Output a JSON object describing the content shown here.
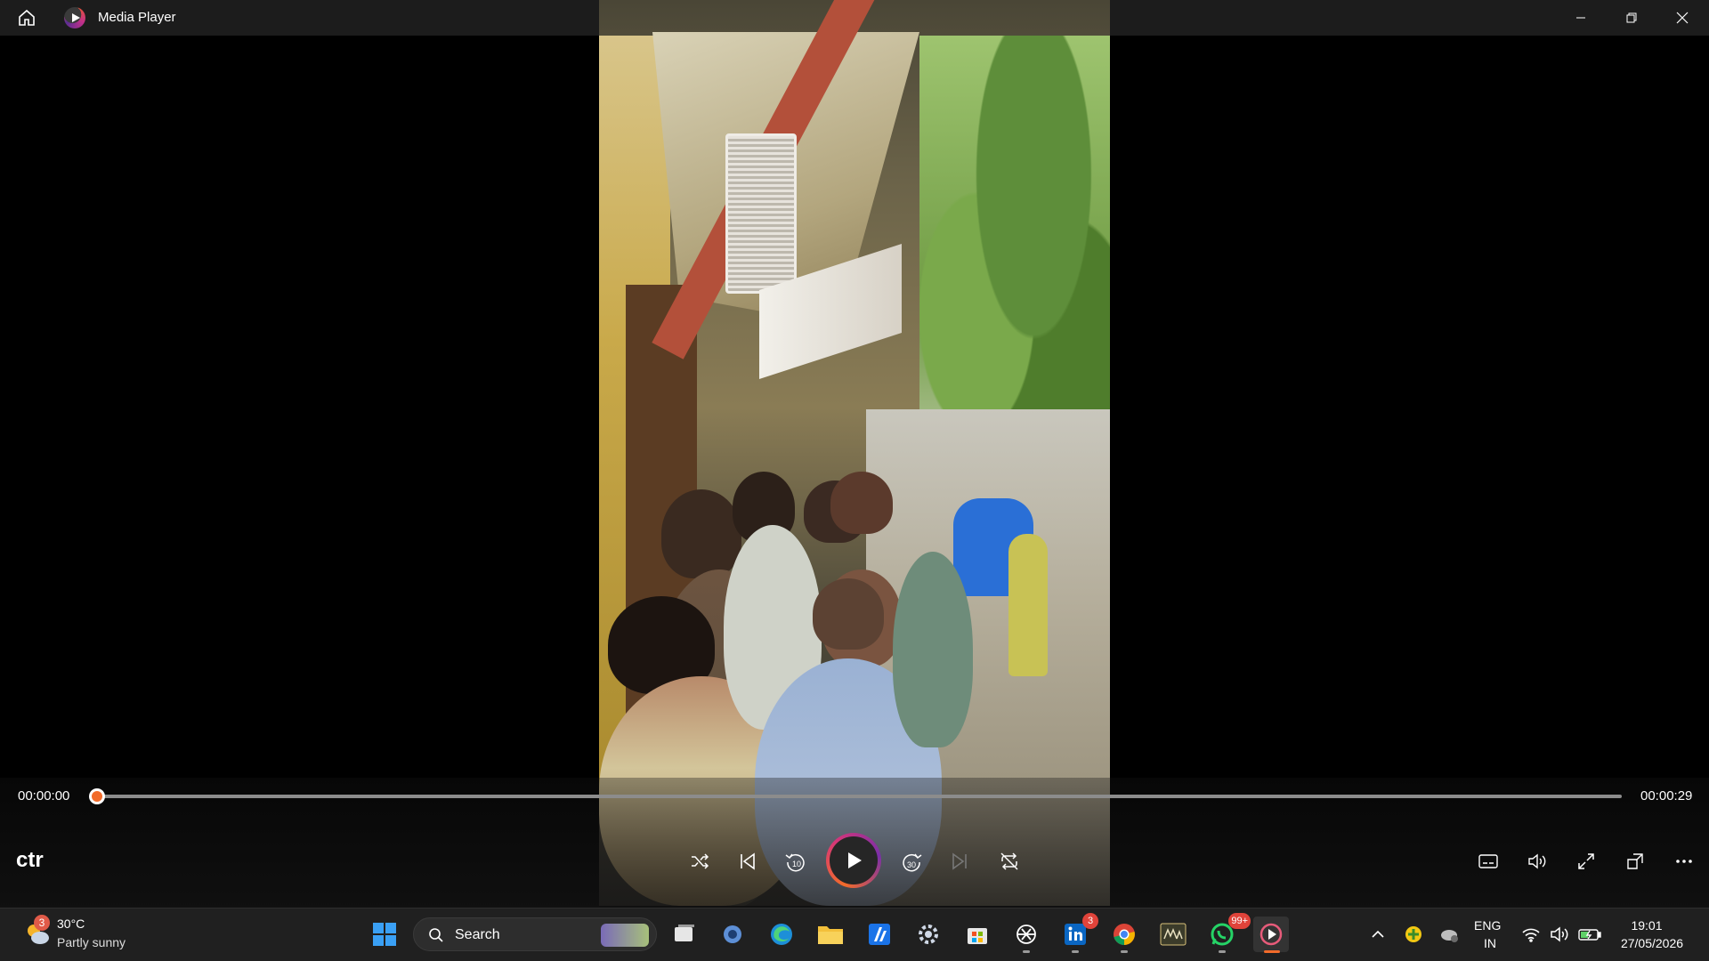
{
  "window": {
    "title": "Media Player"
  },
  "player": {
    "media_title": "ctr",
    "current_time": "00:00:00",
    "total_time": "00:00:29",
    "progress": 0,
    "accent_color": "#f26b2a"
  },
  "controls": {
    "center": [
      "shuffle-icon",
      "previous-icon",
      "rewind-10-icon",
      "play-icon",
      "forward-30-icon",
      "next-icon",
      "repeat-icon"
    ],
    "right": [
      "subtitles-icon",
      "volume-icon",
      "fullscreen-icon",
      "mini-player-icon",
      "more-options-icon"
    ],
    "rewind_label": "10",
    "forward_label": "30"
  },
  "taskbar": {
    "weather": {
      "temperature": "30°C",
      "condition": "Partly sunny",
      "badge": "3"
    },
    "search_placeholder": "Search",
    "linkedin_badge": "3",
    "whatsapp_badge": "99+",
    "language_line1": "ENG",
    "language_line2": "IN",
    "time": "19:01",
    "date": "27/05/2026"
  }
}
